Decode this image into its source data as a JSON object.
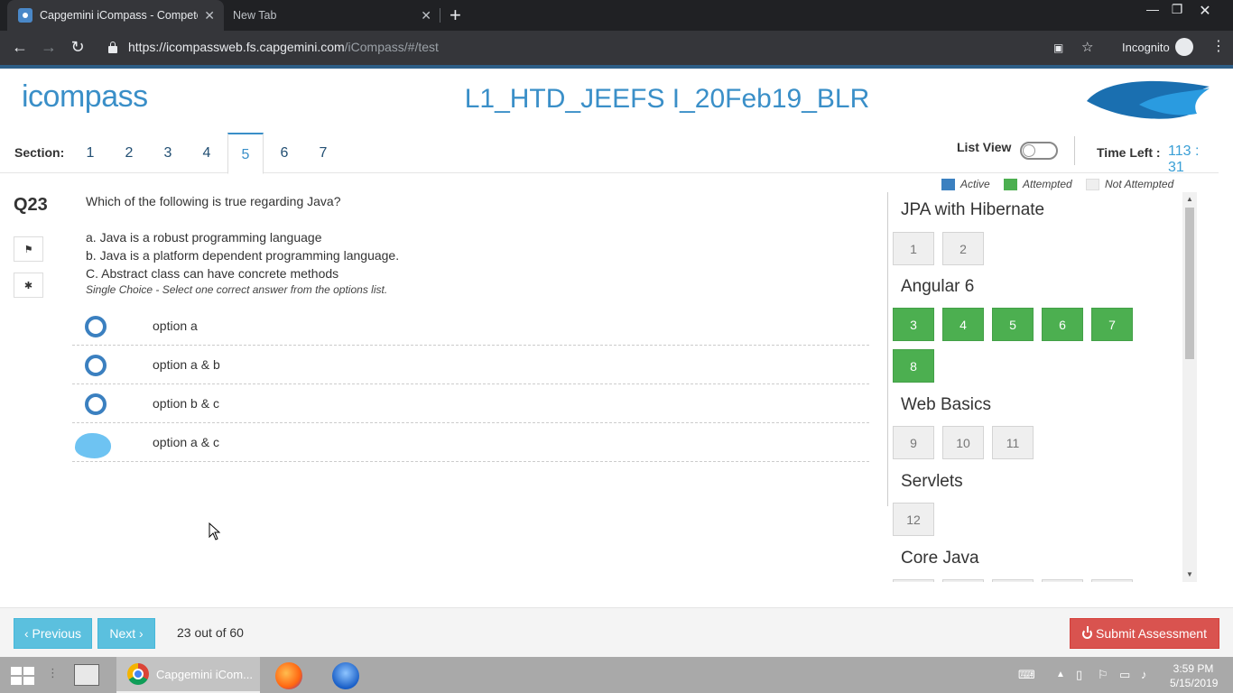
{
  "browser": {
    "active_tab_title": "Capgemini iCompass - Competen",
    "inactive_tab_title": "New Tab",
    "url_host": "https://icompassweb.fs.capgemini.com",
    "url_path": "/iCompass/#/test",
    "incognito_label": "Incognito"
  },
  "header": {
    "logo_text": "icompass",
    "test_title": "L1_HTD_JEEFS I_20Feb19_BLR"
  },
  "sections": {
    "label": "Section:",
    "tabs": [
      "1",
      "2",
      "3",
      "4",
      "5",
      "6",
      "7"
    ],
    "active": "5"
  },
  "controls": {
    "list_view_label": "List View",
    "list_view_on": false,
    "time_left_label": "Time Left :",
    "time_left_value": "113 : 31"
  },
  "question": {
    "number": "Q23",
    "text": "Which of the following is true regarding Java?",
    "statements": [
      "a. Java is a robust programming language",
      "b. Java is a platform dependent programming language.",
      "C. Abstract class can have concrete methods"
    ],
    "hint": "Single Choice - Select one correct answer from the options list.",
    "options": [
      {
        "label": "option a",
        "selected": false
      },
      {
        "label": "option a & b",
        "selected": false
      },
      {
        "label": "option b & c",
        "selected": false
      },
      {
        "label": "option a & c",
        "selected": true
      }
    ]
  },
  "legend": {
    "active": "Active",
    "attempted": "Attempted",
    "not_attempted": "Not Attempted",
    "colors": {
      "active": "#3b80c0",
      "attempted": "#4caf50",
      "not_attempted": "#efefef"
    }
  },
  "panel": {
    "groups": [
      {
        "title": "JPA with Hibernate",
        "questions": [
          {
            "n": "1",
            "status": "not_attempted"
          },
          {
            "n": "2",
            "status": "not_attempted"
          }
        ]
      },
      {
        "title": "Angular 6",
        "questions": [
          {
            "n": "3",
            "status": "attempted"
          },
          {
            "n": "4",
            "status": "attempted"
          },
          {
            "n": "5",
            "status": "attempted"
          },
          {
            "n": "6",
            "status": "attempted"
          },
          {
            "n": "7",
            "status": "attempted"
          },
          {
            "n": "8",
            "status": "attempted"
          }
        ]
      },
      {
        "title": "Web Basics",
        "questions": [
          {
            "n": "9",
            "status": "not_attempted"
          },
          {
            "n": "10",
            "status": "not_attempted"
          },
          {
            "n": "11",
            "status": "not_attempted"
          }
        ]
      },
      {
        "title": "Servlets",
        "questions": [
          {
            "n": "12",
            "status": "not_attempted"
          }
        ]
      },
      {
        "title": "Core Java",
        "questions": []
      }
    ]
  },
  "footer": {
    "previous_label": "‹ Previous",
    "next_label": "Next ›",
    "progress_text": "23 out of 60",
    "submit_label": "Submit Assessment"
  },
  "taskbar": {
    "active_app_label": "Capgemini iCom...",
    "time": "3:59 PM",
    "date": "5/15/2019"
  }
}
